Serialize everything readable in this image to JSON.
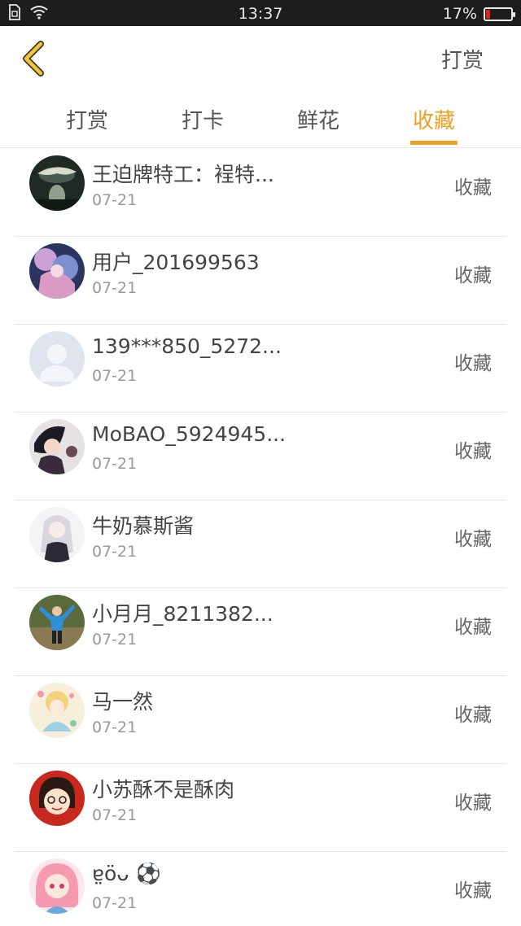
{
  "status_bar": {
    "time": "13:37",
    "battery_percent": "17%",
    "battery_level": 0.17,
    "icons": [
      "sim-icon",
      "wifi-icon",
      "battery-icon"
    ],
    "battery_color": "#e02020"
  },
  "header": {
    "back_icon": "chevron-left-icon",
    "action_label": "打赏"
  },
  "tabs": [
    {
      "label": "打赏",
      "active": false
    },
    {
      "label": "打卡",
      "active": false
    },
    {
      "label": "鲜花",
      "active": false
    },
    {
      "label": "收藏",
      "active": true
    }
  ],
  "colors": {
    "accent": "#f0a020",
    "back_icon": "#f5c23a"
  },
  "users": [
    {
      "name": "王迫牌特工：裎特...",
      "date": "07-21",
      "action": "收藏"
    },
    {
      "name": "用户_201699563",
      "date": "07-21",
      "action": "收藏"
    },
    {
      "name": "139***850_5272...",
      "date": "07-21",
      "action": "收藏"
    },
    {
      "name": "MoBAO_5924945...",
      "date": "07-21",
      "action": "收藏"
    },
    {
      "name": "牛奶慕斯酱",
      "date": "07-21",
      "action": "收藏"
    },
    {
      "name": "小月月_8211382...",
      "date": "07-21",
      "action": "收藏"
    },
    {
      "name": "马一然",
      "date": "07-21",
      "action": "收藏"
    },
    {
      "name": "小苏酥不是酥肉",
      "date": "07-21",
      "action": "收藏"
    },
    {
      "name": "ɐ̤öᴗ ⚽",
      "date": "07-21",
      "action": "收藏"
    }
  ]
}
